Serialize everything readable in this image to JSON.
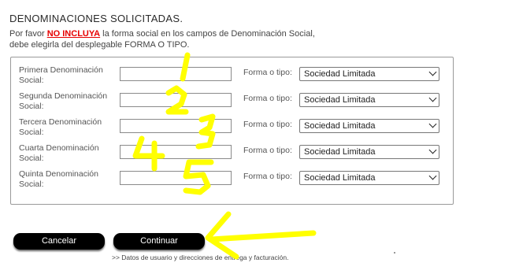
{
  "header": {
    "title": "DENOMINACIONES SOLICITADAS.",
    "intro_prefix": "Por favor ",
    "intro_warning": "NO INCLUYA",
    "intro_suffix": " la forma social en los campos de Denominación Social,",
    "intro_line2": "debe elegirla del desplegable FORMA O TIPO."
  },
  "rows": [
    {
      "label_line1": "Primera Denominación",
      "label_line2": "Social:",
      "value": "",
      "type_label": "Forma o tipo:",
      "type_value": "Sociedad Limitada"
    },
    {
      "label_line1": "Segunda Denominación",
      "label_line2": "Social:",
      "value": "",
      "type_label": "Forma o tipo:",
      "type_value": "Sociedad Limitada"
    },
    {
      "label_line1": "Tercera Denominación",
      "label_line2": "Social:",
      "value": "",
      "type_label": "Forma o tipo:",
      "type_value": "Sociedad Limitada"
    },
    {
      "label_line1": "Cuarta Denominación",
      "label_line2": "Social:",
      "value": "",
      "type_label": "Forma o tipo:",
      "type_value": "Sociedad Limitada"
    },
    {
      "label_line1": "Quinta Denominación",
      "label_line2": "Social:",
      "value": "",
      "type_label": "Forma o tipo:",
      "type_value": "Sociedad Limitada"
    }
  ],
  "buttons": {
    "cancel": "Cancelar",
    "continue": "Continuar"
  },
  "footer_note": ">> Datos de usuario y direcciones de entrega y facturación.",
  "annotations": {
    "color": "#ffff00",
    "numbers": [
      "1",
      "2",
      "3",
      "4",
      "5"
    ]
  }
}
